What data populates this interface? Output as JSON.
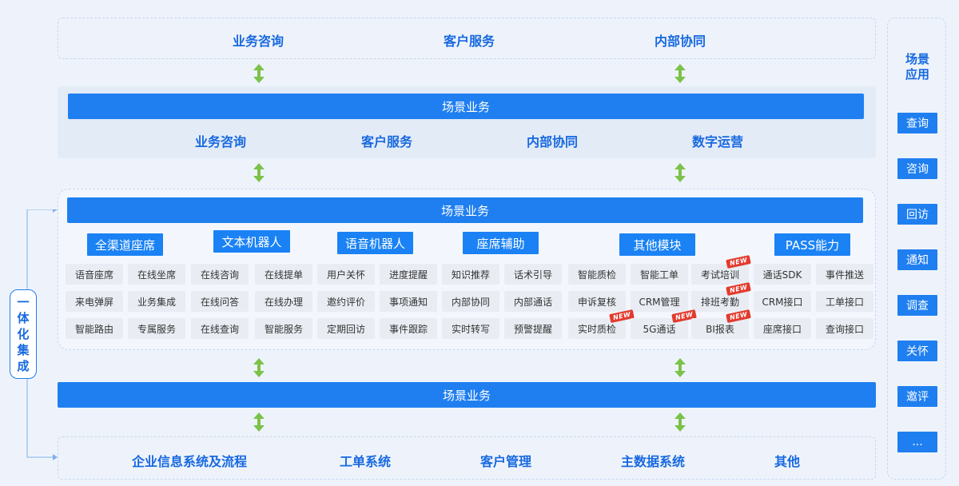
{
  "top_row": [
    "业务咨询",
    "客户服务",
    "内部协同"
  ],
  "scene_bar_1": "场景业务",
  "scene_row_2": [
    "业务咨询",
    "客户服务",
    "内部协同",
    "数字运营"
  ],
  "scene_bar_2": "场景业务",
  "categories": [
    "全渠道座席",
    "文本机器人",
    "语音机器人",
    "座席辅助",
    "其他模块",
    "PASS能力"
  ],
  "cells": [
    [
      "语音座席",
      "在线坐席",
      "在线咨询",
      "在线提单",
      "用户关怀",
      "进度提醒",
      "知识推荐",
      "话术引导",
      "智能质检",
      "智能工单",
      "考试培训",
      "通话SDK",
      "事件推送"
    ],
    [
      "来电弹屏",
      "业务集成",
      "在线问答",
      "在线办理",
      "邀约评价",
      "事项通知",
      "内部协同",
      "内部通话",
      "申诉复核",
      "CRM管理",
      "排班考勤",
      "CRM接口",
      "工单接口"
    ],
    [
      "智能路由",
      "专属服务",
      "在线查询",
      "智能服务",
      "定期回访",
      "事件跟踪",
      "实时转写",
      "预警提醒",
      "实时质检",
      "5G通话",
      "BI报表",
      "座席接口",
      "查询接口"
    ]
  ],
  "new_badge": "NEW",
  "scene_bar_3": "场景业务",
  "bottom_row": [
    "企业信息系统及流程",
    "工单系统",
    "客户管理",
    "主数据系统",
    "其他"
  ],
  "integration_label": [
    "一",
    "体",
    "化",
    "集",
    "成"
  ],
  "side_title": [
    "场景",
    "应用"
  ],
  "side_buttons": [
    "查询",
    "咨询",
    "回访",
    "通知",
    "调查",
    "关怀",
    "邀评",
    "..."
  ],
  "colors": {
    "primary": "#1f7ff0",
    "arrow": "#7cc24a",
    "badge": "#e23b2e"
  }
}
